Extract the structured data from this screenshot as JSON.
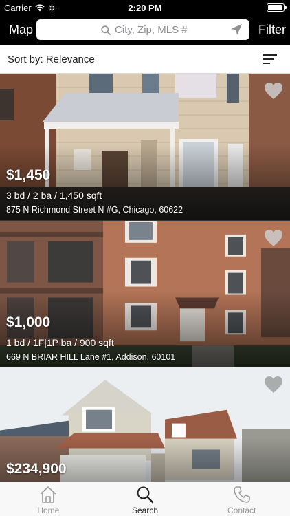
{
  "status_bar": {
    "carrier": "Carrier",
    "time": "2:20 PM",
    "battery_level": 0.95
  },
  "nav": {
    "left_label": "Map",
    "right_label": "Filter",
    "search_placeholder": "City, Zip, MLS #"
  },
  "sort": {
    "label": "Sort by: Relevance"
  },
  "listings": [
    {
      "price": "$1,450",
      "details": "3 bd / 2 ba / 1,450 sqft",
      "address": "875 N Richmond Street N #G, Chicago, 60622"
    },
    {
      "price": "$1,000",
      "details": "1 bd / 1F|1P ba / 900 sqft",
      "address": "669 N BRIAR HILL Lane #1, Addison, 60101"
    },
    {
      "price": "$234,900",
      "details": "",
      "address": ""
    }
  ],
  "tabs": [
    {
      "label": "Home",
      "icon": "home-icon",
      "active": false
    },
    {
      "label": "Search",
      "icon": "search-icon",
      "active": true
    },
    {
      "label": "Contact",
      "icon": "phone-icon",
      "active": false
    }
  ],
  "colors": {
    "bar_background": "#000000",
    "tab_active": "#222222",
    "tab_inactive": "#9a9a9a"
  }
}
